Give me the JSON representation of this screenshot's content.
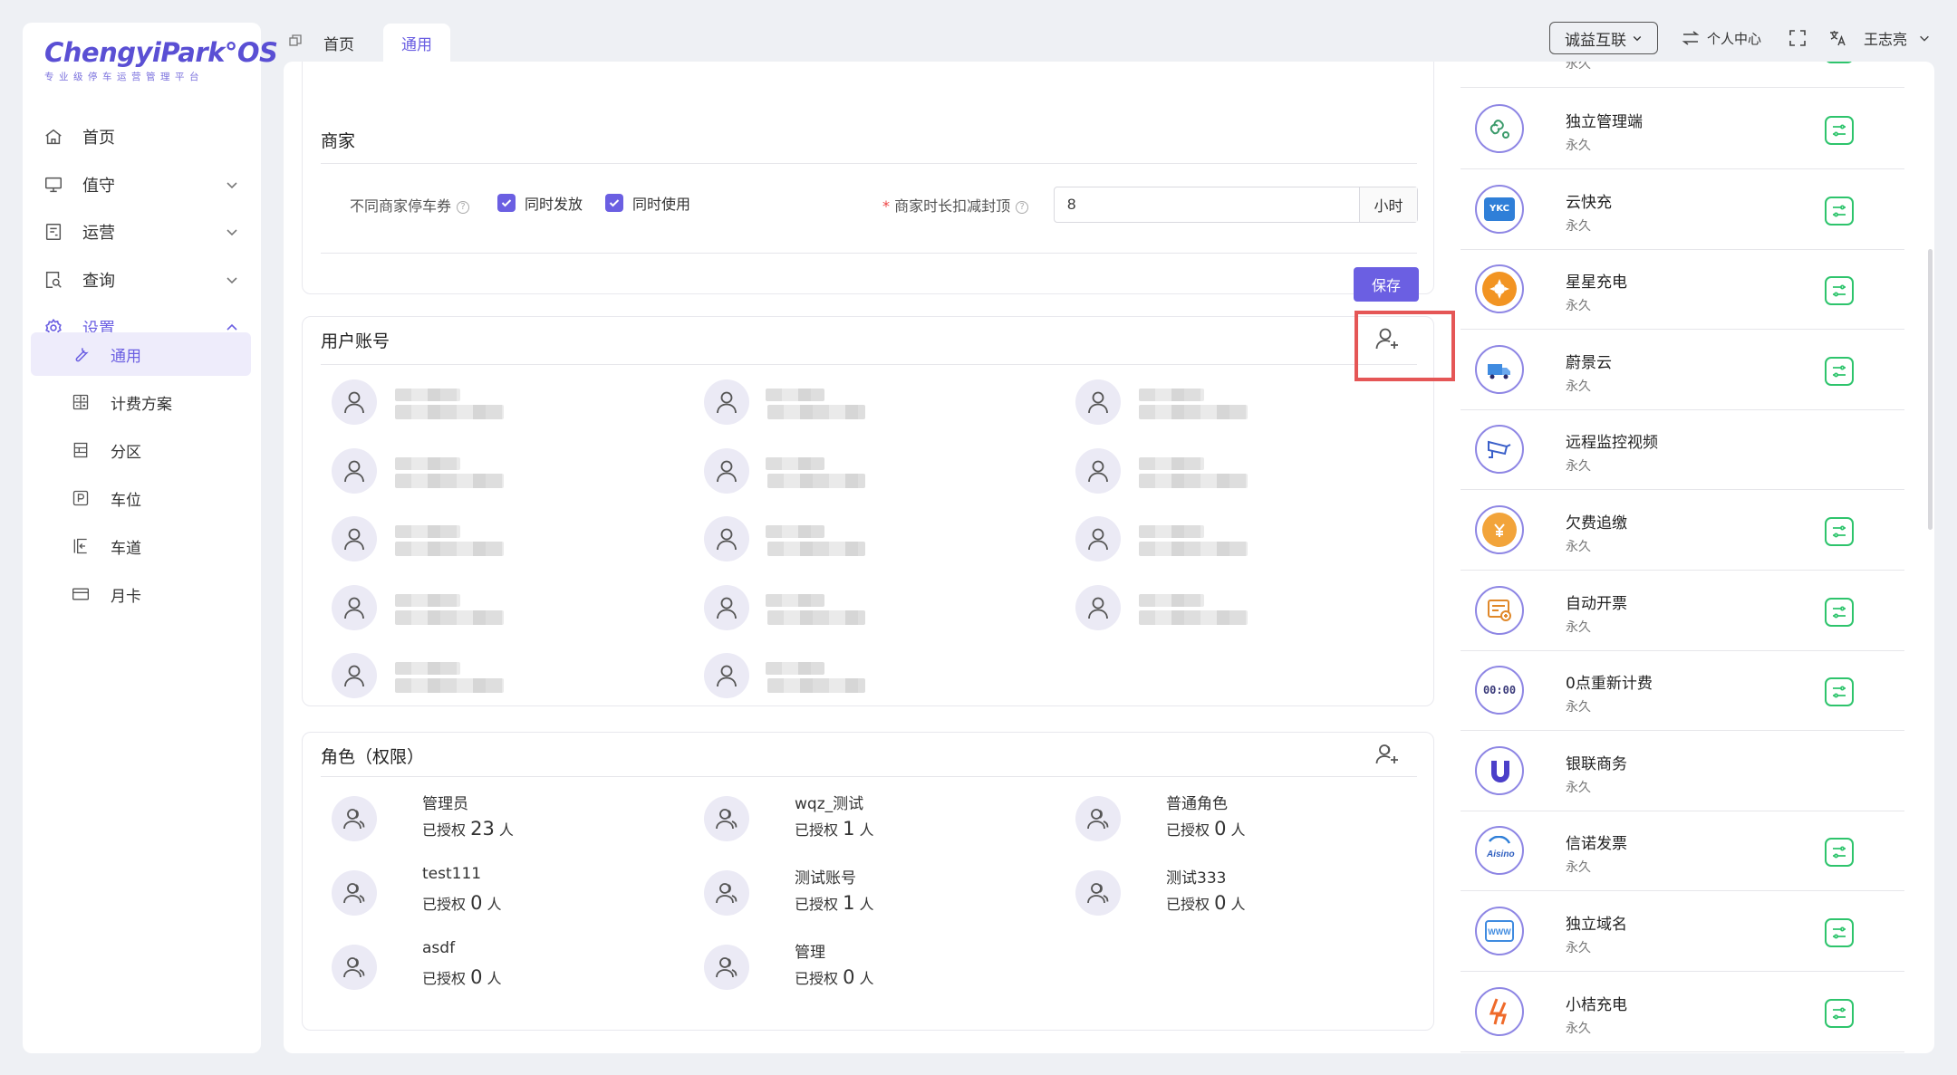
{
  "logo": {
    "title": "ChengyiPark°OS",
    "subtitle": "专业级停车运营管理平台"
  },
  "nav": {
    "items": [
      {
        "label": "首页",
        "icon": "home-icon"
      },
      {
        "label": "值守",
        "icon": "monitor-icon"
      },
      {
        "label": "运营",
        "icon": "clipboard-icon"
      },
      {
        "label": "查询",
        "icon": "search-doc-icon"
      },
      {
        "label": "设置",
        "icon": "gear-icon"
      }
    ],
    "sub": [
      {
        "label": "通用",
        "icon": "wrench-icon"
      },
      {
        "label": "计费方案",
        "icon": "calculator-icon"
      },
      {
        "label": "分区",
        "icon": "partition-icon"
      },
      {
        "label": "车位",
        "icon": "parking-icon"
      },
      {
        "label": "车道",
        "icon": "lane-icon"
      },
      {
        "label": "月卡",
        "icon": "card-icon"
      }
    ]
  },
  "tabs": {
    "home": "首页",
    "general": "通用"
  },
  "topbar": {
    "org": "诚益互联",
    "personal": "个人中心",
    "user": "王志亮"
  },
  "merchant": {
    "title": "商家",
    "coupon_label": "不同商家停车券",
    "opt1": "同时发放",
    "opt2": "同时使用",
    "limit_label": "商家时长扣减封顶",
    "limit_value": "8",
    "limit_unit": "小时",
    "save": "保存"
  },
  "users": {
    "title": "用户账号"
  },
  "roles": {
    "title": "角色（权限）",
    "prefix": "已授权",
    "suffix": "人",
    "items": [
      {
        "name": "管理员",
        "count": "23"
      },
      {
        "name": "wqz_测试",
        "count": "1"
      },
      {
        "name": "普通角色",
        "count": "0"
      },
      {
        "name": "test111",
        "count": "0"
      },
      {
        "name": "测试账号",
        "count": "1"
      },
      {
        "name": "测试333",
        "count": "0"
      },
      {
        "name": "asdf",
        "count": "0"
      },
      {
        "name": "管理",
        "count": "0"
      }
    ]
  },
  "apps": {
    "partial_sub": "永久",
    "items": [
      {
        "name": "独立管理端",
        "sub": "永久",
        "icon": "link-gear-icon",
        "color": "#ffffff",
        "action": true
      },
      {
        "name": "云快充",
        "sub": "永久",
        "icon": "ykc-icon",
        "color": "#2f7fd8",
        "action": true
      },
      {
        "name": "星星充电",
        "sub": "永久",
        "icon": "star-charge-icon",
        "color": "#f29422",
        "action": true
      },
      {
        "name": "蔚景云",
        "sub": "永久",
        "icon": "cloud-truck-icon",
        "color": "#ffffff",
        "action": true
      },
      {
        "name": "远程监控视频",
        "sub": "永久",
        "icon": "camera-icon",
        "color": "#ffffff",
        "action": false
      },
      {
        "name": "欠费追缴",
        "sub": "永久",
        "icon": "coin-icon",
        "color": "#f2a43a",
        "action": true
      },
      {
        "name": "自动开票",
        "sub": "永久",
        "icon": "invoice-icon",
        "color": "#ffffff",
        "action": true
      },
      {
        "name": "0点重新计费",
        "sub": "永久",
        "icon": "clock-icon",
        "color": "#ffffff",
        "action": true
      },
      {
        "name": "银联商务",
        "sub": "永久",
        "icon": "unionpay-icon",
        "color": "#4b3fc9",
        "action": false
      },
      {
        "name": "信诺发票",
        "sub": "永久",
        "icon": "aisino-icon",
        "color": "#ffffff",
        "action": true
      },
      {
        "name": "独立域名",
        "sub": "永久",
        "icon": "www-icon",
        "color": "#ffffff",
        "action": true
      },
      {
        "name": "小桔充电",
        "sub": "永久",
        "icon": "bolt-icon",
        "color": "#ffffff",
        "action": true
      }
    ],
    "ykc_text": "YKC",
    "clock_text": "00:00",
    "www_text": "WWW"
  }
}
